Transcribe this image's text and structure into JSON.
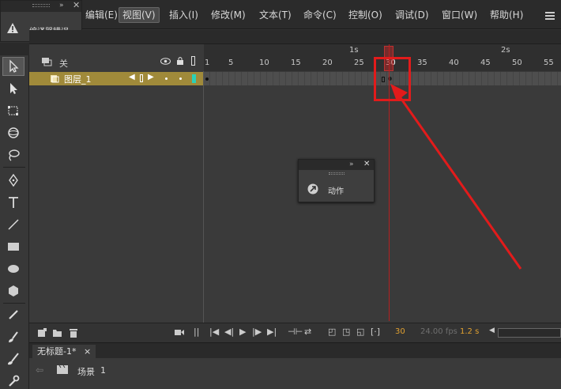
{
  "menubar": {
    "items": [
      "编辑(E)",
      "视图(V)",
      "插入(I)",
      "修改(M)",
      "文本(T)",
      "命令(C)",
      "控制(O)",
      "调试(D)",
      "窗口(W)",
      "帮助(H)"
    ],
    "active_index": 1
  },
  "error_panel": {
    "label": "编译器错误"
  },
  "timeline": {
    "layer_header_label": "关",
    "layer_name": "图层_1",
    "seconds_labels": [
      "1s",
      "2s"
    ],
    "frame_numbers": [
      "1",
      "5",
      "10",
      "15",
      "20",
      "25",
      "30",
      "35",
      "40",
      "45",
      "50",
      "55"
    ],
    "current_frame": "30",
    "fps": "24.00 fps",
    "elapsed": "1.2 s"
  },
  "actions_panel": {
    "label": "动作"
  },
  "document": {
    "tab_label": "无标题-1*",
    "tab_close": "×",
    "scene_label": "场景",
    "scene_number": "1"
  },
  "colors": {
    "highlight": "#e21b1b",
    "layer_row": "#a08a3a",
    "playhead": "#b52020",
    "frame_text": "#e0a030"
  }
}
